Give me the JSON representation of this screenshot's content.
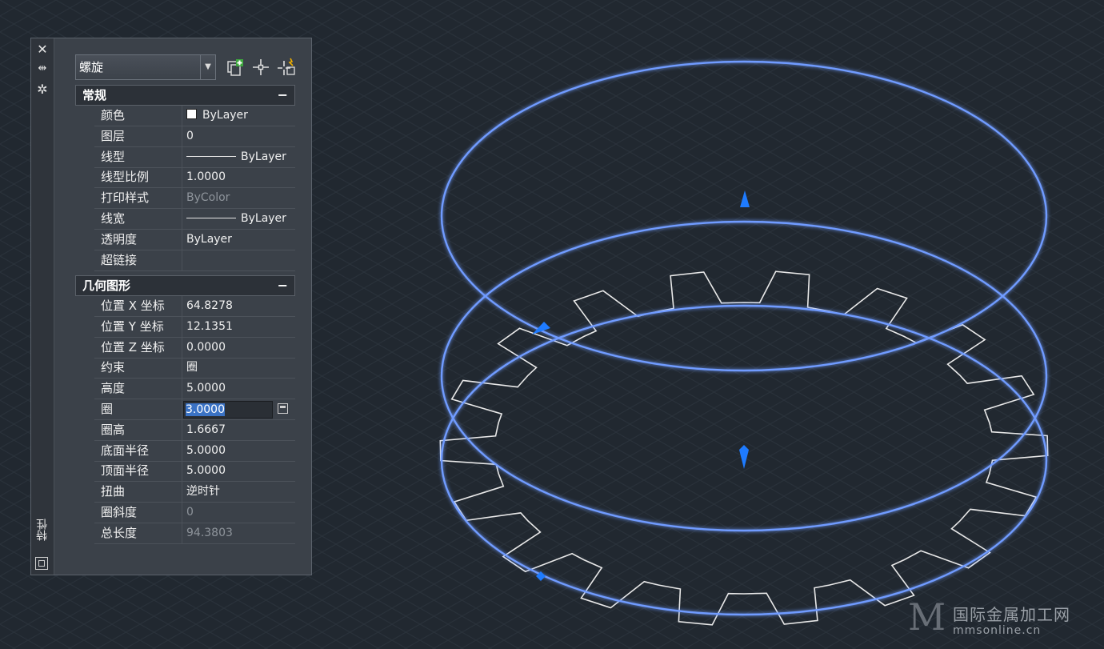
{
  "palette": {
    "vertical_title": "特性",
    "object_type": "螺旋",
    "sections": {
      "general": {
        "title": "常规",
        "collapse_symbol": "−",
        "rows": [
          {
            "name": "颜色",
            "value": "ByLayer"
          },
          {
            "name": "图层",
            "value": "0"
          },
          {
            "name": "线型",
            "value": "ByLayer"
          },
          {
            "name": "线型比例",
            "value": "1.0000"
          },
          {
            "name": "打印样式",
            "value": "ByColor"
          },
          {
            "name": "线宽",
            "value": "ByLayer"
          },
          {
            "name": "透明度",
            "value": "ByLayer"
          },
          {
            "name": "超链接",
            "value": ""
          }
        ]
      },
      "geometry": {
        "title": "几何图形",
        "collapse_symbol": "−",
        "rows": [
          {
            "name": "位置 X 坐标",
            "value": "64.8278"
          },
          {
            "name": "位置 Y 坐标",
            "value": "12.1351"
          },
          {
            "name": "位置 Z 坐标",
            "value": "0.0000"
          },
          {
            "name": "约束",
            "value": "圈"
          },
          {
            "name": "高度",
            "value": "5.0000"
          },
          {
            "name": "圈",
            "value": "3.0000"
          },
          {
            "name": "圈高",
            "value": "1.6667"
          },
          {
            "name": "底面半径",
            "value": "5.0000"
          },
          {
            "name": "顶面半径",
            "value": "5.0000"
          },
          {
            "name": "扭曲",
            "value": "逆时针"
          },
          {
            "name": "圈斜度",
            "value": "0"
          },
          {
            "name": "总长度",
            "value": "94.3803"
          }
        ]
      }
    },
    "icons": {
      "close": "close-icon",
      "autohide": "autohide-icon",
      "settings": "settings-icon",
      "quick_select": "quick-select-icon",
      "select_objects": "select-objects-icon",
      "toggle_pickadd": "pickadd-icon"
    }
  },
  "watermark": {
    "logo": "M",
    "cn": "国际金属加工网",
    "en": "mmsonline.cn"
  },
  "colors": {
    "background": "#212830",
    "helix": "#6f9bff",
    "grip": "#1e7bff",
    "gear": "#e8e8e8"
  }
}
